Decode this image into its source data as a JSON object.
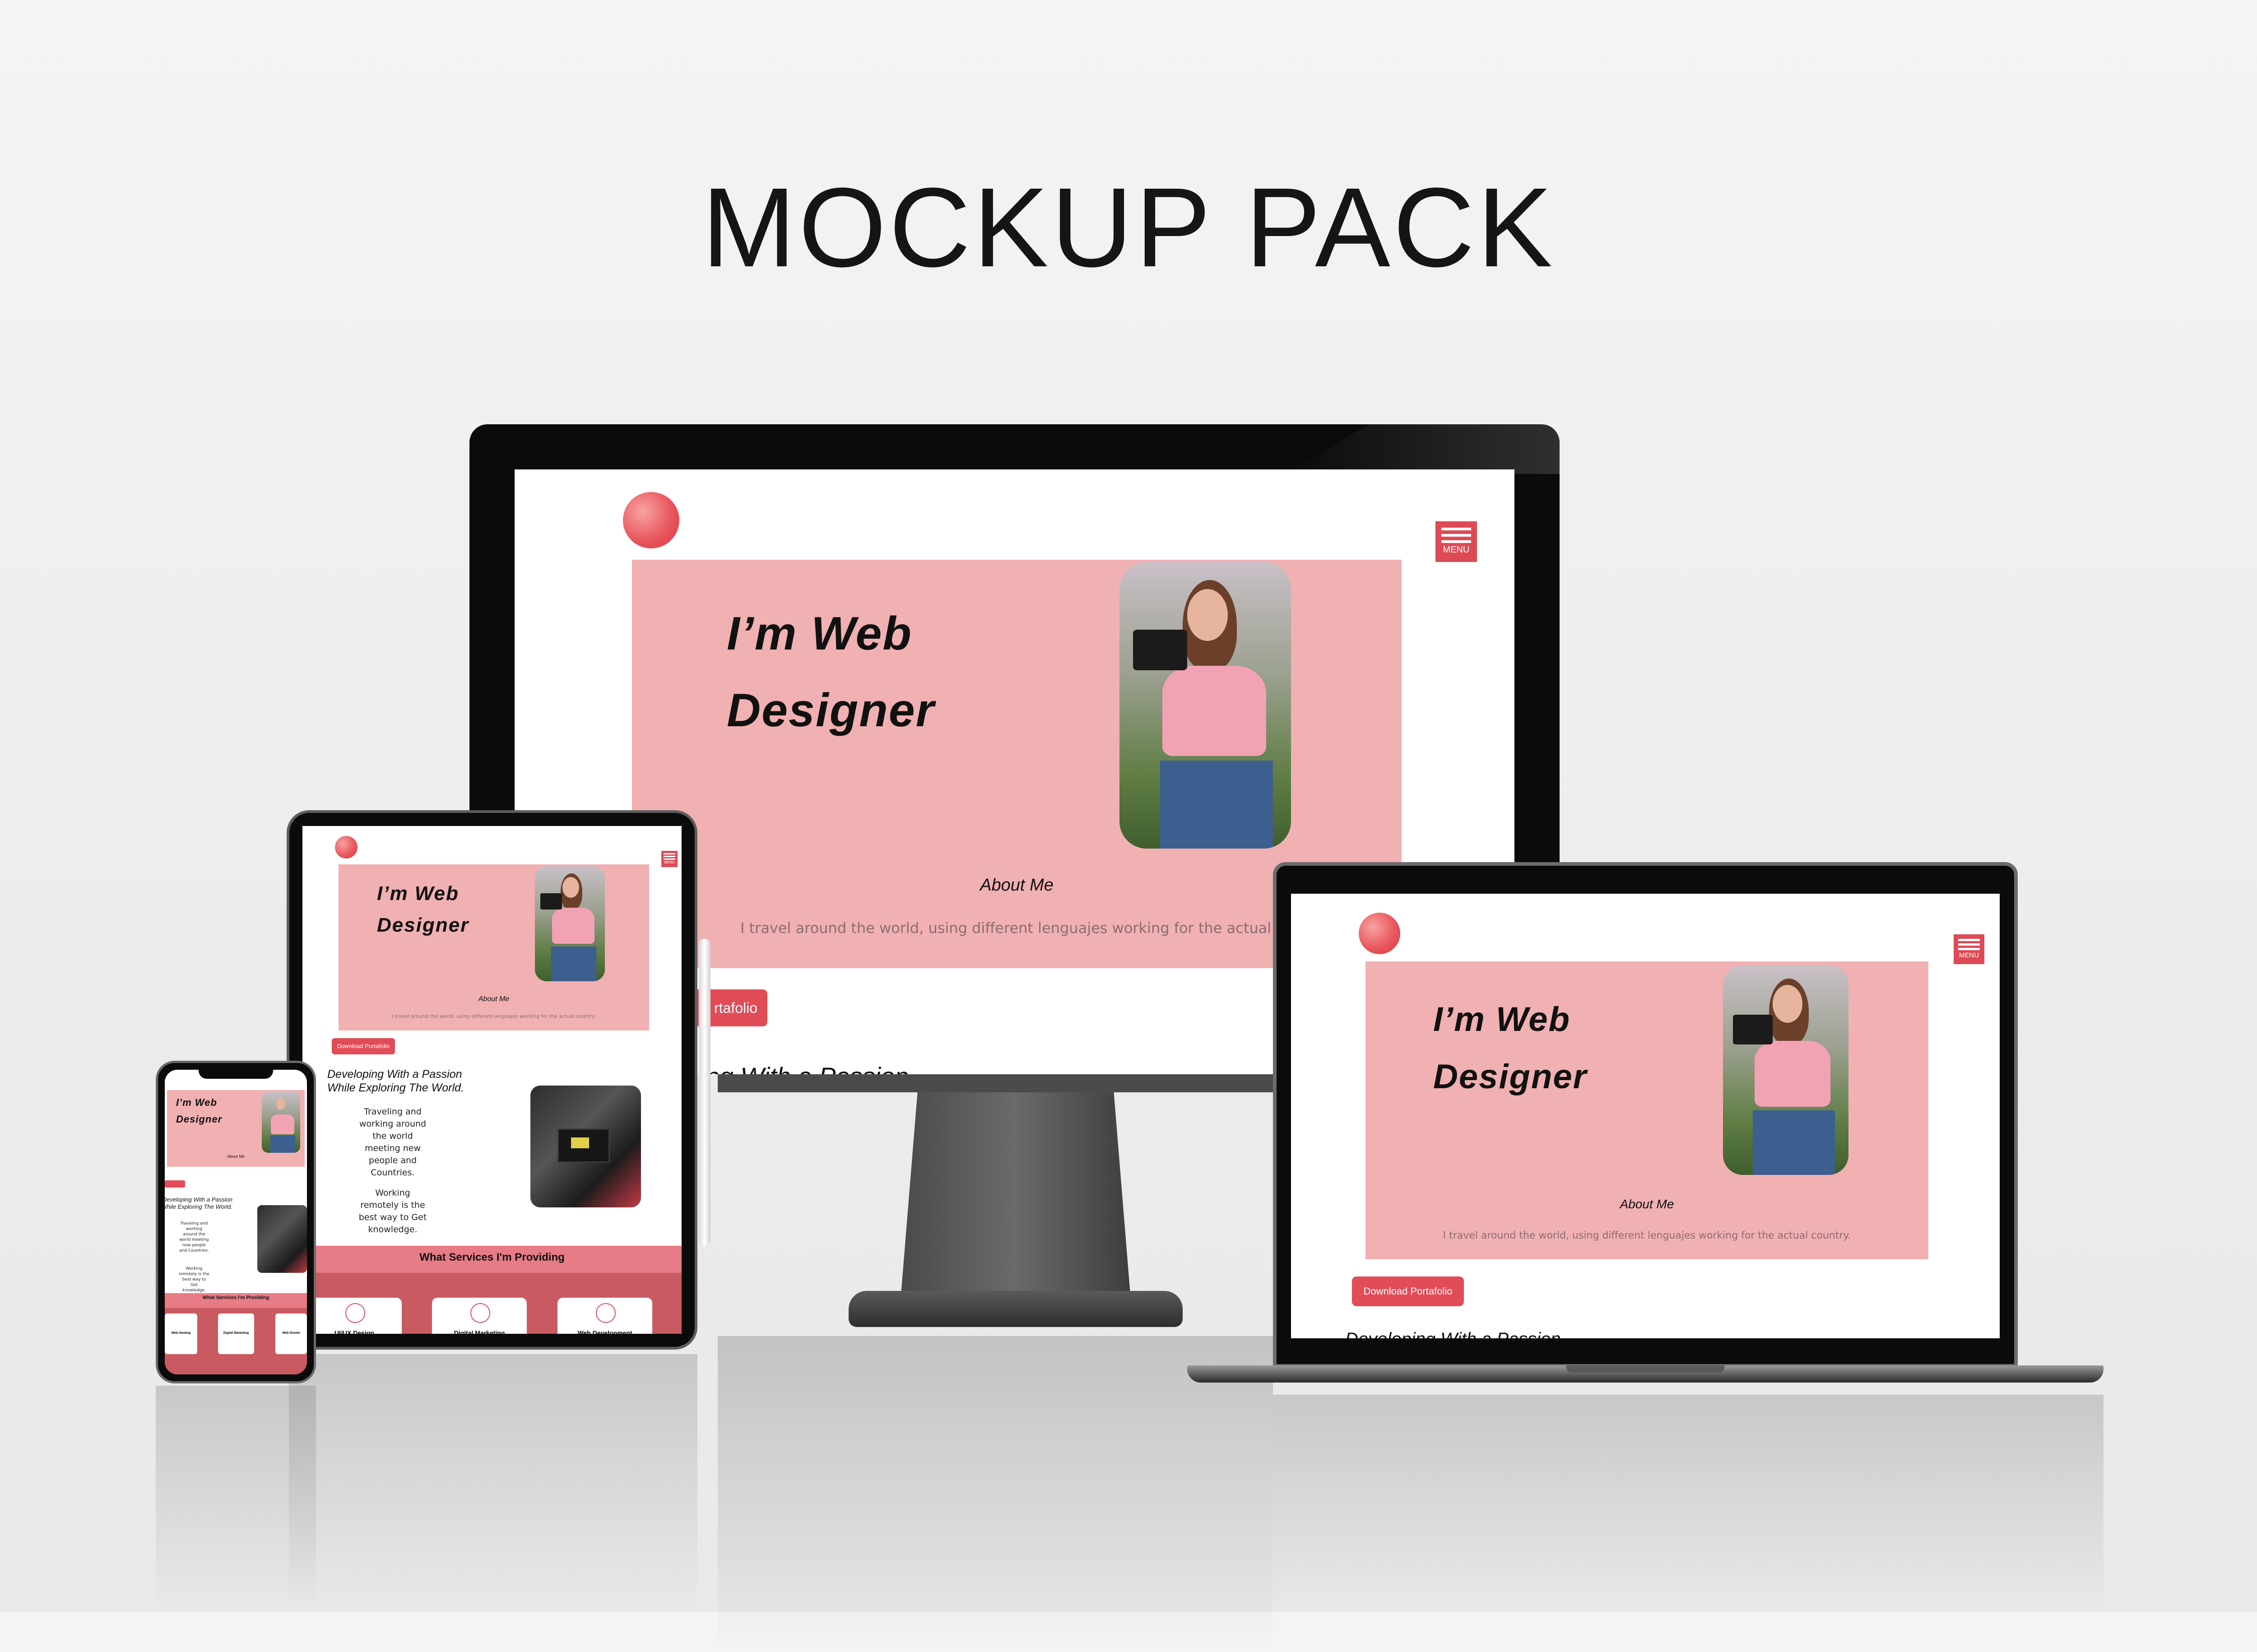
{
  "heading": "MOCKUP PACK",
  "site": {
    "menu_label": "MENU",
    "hero_line1": "I’m Web",
    "hero_line2": "Designer",
    "about_title": "About Me",
    "about_text": "I travel around the world, using different lenguajes working for the actual country.",
    "download_button": "Download Portafolio",
    "section_heading": "Developing With a Passion While Exploring The World.",
    "travel_text": "Traveling and working around the world meeting new people and Countries.",
    "remote_text": "Working remotely is the best way to Get knowledge.",
    "services_heading": "What Services I'm Providing",
    "services": [
      "UI/UX Design",
      "Digital Marketing",
      "Web Development"
    ],
    "phone_services": [
      "Web Hosting",
      "Digital Marketing",
      "Web Develo"
    ]
  },
  "desktop_partial": {
    "button_fragment": "rtafolio",
    "about_text_fragment": "I travel around the world, using different lenguajes working for the actual count",
    "heading_fragment": "ing With a Passion"
  },
  "laptop_partial": {
    "heading_fragment": "Developing With a Passion"
  },
  "colors": {
    "accent": "#e14c57",
    "hero_pink": "#f1b0b2",
    "device_frame": "#0b0b0b"
  }
}
